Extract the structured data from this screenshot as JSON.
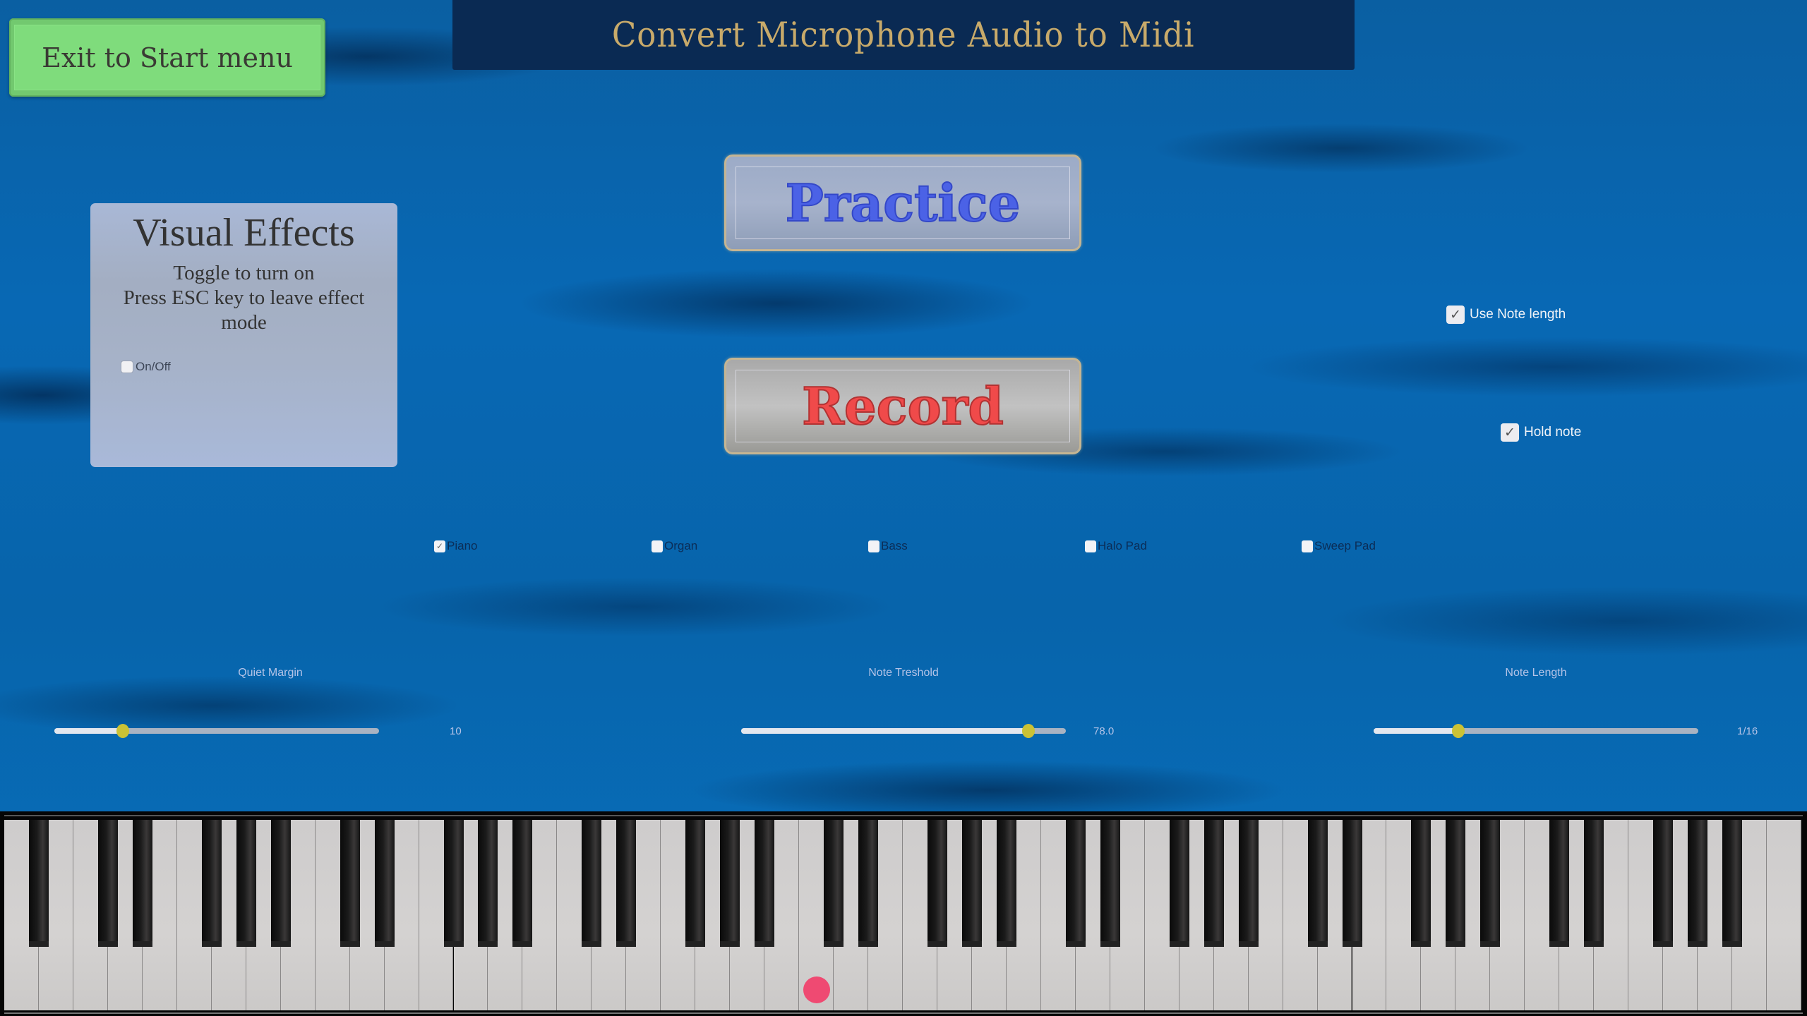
{
  "header": {
    "exit_button_label": "Exit to Start menu",
    "title": "Convert Microphone Audio to Midi"
  },
  "visual_effects": {
    "title": "Visual Effects",
    "description_lines": [
      "Toggle to turn on",
      "Press ESC key to leave effect",
      "mode"
    ],
    "toggle_label": "On/Off",
    "toggle_checked": false
  },
  "actions": {
    "practice_label": "Practice",
    "record_label": "Record"
  },
  "options": {
    "use_note_length": {
      "label": "Use Note length",
      "checked": true
    },
    "hold_note": {
      "label": "Hold note",
      "checked": true
    }
  },
  "instruments": [
    {
      "label": "Piano",
      "checked": true
    },
    {
      "label": "Organ",
      "checked": false
    },
    {
      "label": "Bass",
      "checked": false
    },
    {
      "label": "Halo Pad",
      "checked": false
    },
    {
      "label": "Sweep Pad",
      "checked": false
    }
  ],
  "sliders": [
    {
      "label": "Quiet Margin",
      "value_text": "10",
      "fraction": 0.21
    },
    {
      "label": "Note Treshold",
      "value_text": "78.0",
      "fraction": 0.885
    },
    {
      "label": "Note Length",
      "value_text": "1/16",
      "fraction": 0.26
    }
  ],
  "keyboard": {
    "lowest_note": "A0",
    "highest_note": "C8",
    "key_count": 88,
    "active_marker_note": "C4"
  },
  "colors": {
    "exit_button": "#7fdc7c",
    "title_bar": "#0a2a53",
    "title_text": "#c8aa6a",
    "practice_text": "#4b62e6",
    "record_text": "#f04a4a",
    "slider_thumb": "#cbc235",
    "note_marker": "#ef4a72"
  },
  "icons": {
    "checkbox_checked": "check-mark",
    "checkbox_unchecked": "empty-box"
  }
}
